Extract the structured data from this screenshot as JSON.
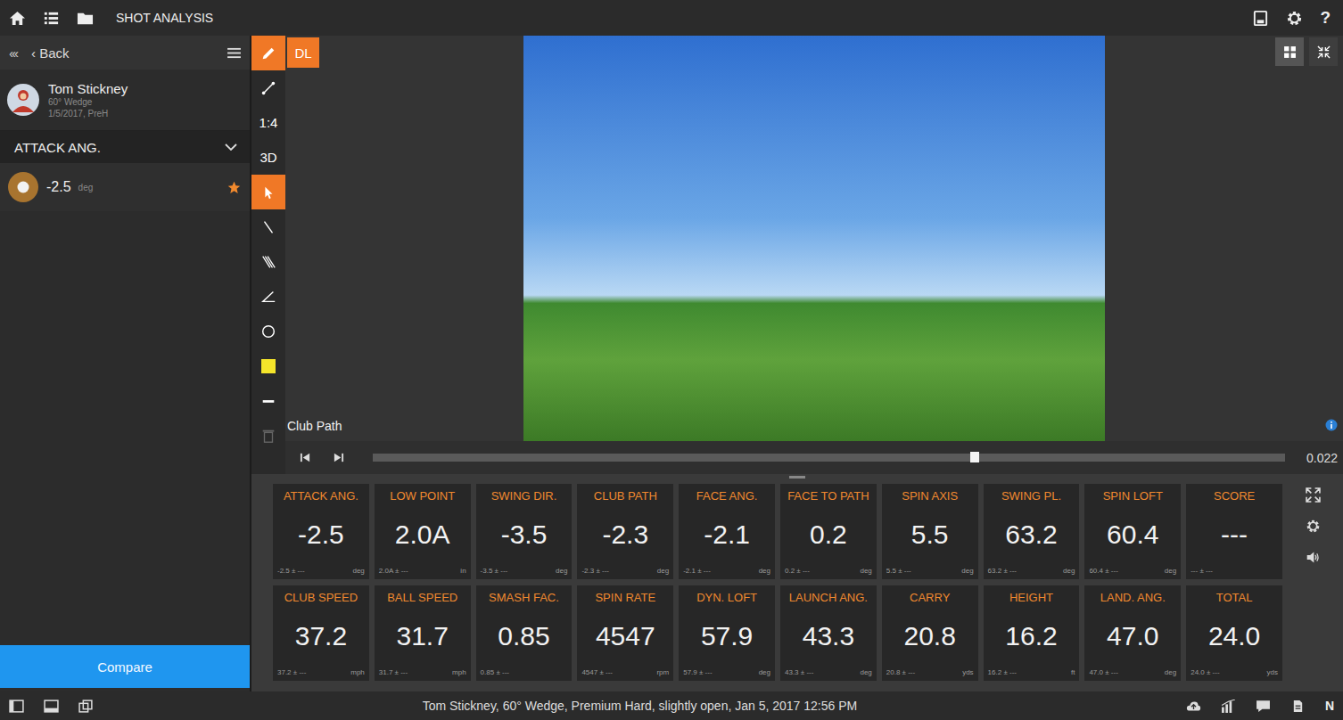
{
  "topbar": {
    "title": "SHOT ANALYSIS",
    "help": "?"
  },
  "sidebar": {
    "collapse": "‹‹‹",
    "back": "‹ Back",
    "player": {
      "name": "Tom Stickney",
      "club": "60° Wedge",
      "session": "1/5/2017, PreH"
    },
    "section": {
      "label": "ATTACK ANG.",
      "expanded": true
    },
    "shots": [
      {
        "value": "-2.5",
        "unit": "deg",
        "starred": true,
        "selected": true
      }
    ],
    "compare": "Compare"
  },
  "tools": [
    {
      "kind": "pencil",
      "selected": true
    },
    {
      "kind": "segment",
      "selected": false
    },
    {
      "kind": "text",
      "label": "1:4",
      "selected": false
    },
    {
      "kind": "text",
      "label": "3D",
      "selected": false
    },
    {
      "kind": "cursor",
      "selected": true
    },
    {
      "kind": "line",
      "selected": false
    },
    {
      "kind": "parallel",
      "selected": false
    },
    {
      "kind": "angle",
      "selected": false
    },
    {
      "kind": "circle",
      "selected": false
    },
    {
      "kind": "swatch",
      "selected": false
    },
    {
      "kind": "dash",
      "selected": false
    },
    {
      "kind": "trash",
      "selected": false
    }
  ],
  "dl": {
    "label": "DL",
    "on": true
  },
  "viewer": {
    "overlay_label": "Club Path",
    "time": "0.022",
    "level": 0.66,
    "grid_on": true
  },
  "metrics": [
    {
      "label": "ATTACK ANG.",
      "value": "-2.5",
      "sub": "-2.5 ± ---",
      "unit": "deg"
    },
    {
      "label": "LOW POINT",
      "value": "2.0A",
      "sub": "2.0A ± ---",
      "unit": "in"
    },
    {
      "label": "SWING DIR.",
      "value": "-3.5",
      "sub": "-3.5 ± ---",
      "unit": "deg"
    },
    {
      "label": "CLUB PATH",
      "value": "-2.3",
      "sub": "-2.3 ± ---",
      "unit": "deg"
    },
    {
      "label": "FACE ANG.",
      "value": "-2.1",
      "sub": "-2.1 ± ---",
      "unit": "deg"
    },
    {
      "label": "FACE TO PATH",
      "value": "0.2",
      "sub": "0.2 ± ---",
      "unit": "deg"
    },
    {
      "label": "SPIN AXIS",
      "value": "5.5",
      "sub": "5.5 ± ---",
      "unit": "deg"
    },
    {
      "label": "SWING PL.",
      "value": "63.2",
      "sub": "63.2 ± ---",
      "unit": "deg"
    },
    {
      "label": "SPIN LOFT",
      "value": "60.4",
      "sub": "60.4 ± ---",
      "unit": "deg"
    },
    {
      "label": "SCORE",
      "value": "---",
      "sub": "--- ± ---",
      "unit": ""
    },
    {
      "label": "CLUB SPEED",
      "value": "37.2",
      "sub": "37.2 ± ---",
      "unit": "mph"
    },
    {
      "label": "BALL SPEED",
      "value": "31.7",
      "sub": "31.7 ± ---",
      "unit": "mph"
    },
    {
      "label": "SMASH FAC.",
      "value": "0.85",
      "sub": "0.85 ± ---",
      "unit": ""
    },
    {
      "label": "SPIN RATE",
      "value": "4547",
      "sub": "4547 ± ---",
      "unit": "rpm"
    },
    {
      "label": "DYN. LOFT",
      "value": "57.9",
      "sub": "57.9 ± ---",
      "unit": "deg"
    },
    {
      "label": "LAUNCH ANG.",
      "value": "43.3",
      "sub": "43.3 ± ---",
      "unit": "deg"
    },
    {
      "label": "CARRY",
      "value": "20.8",
      "sub": "20.8 ± ---",
      "unit": "yds"
    },
    {
      "label": "HEIGHT",
      "value": "16.2",
      "sub": "16.2 ± ---",
      "unit": "ft"
    },
    {
      "label": "LAND. ANG.",
      "value": "47.0",
      "sub": "47.0 ± ---",
      "unit": "deg"
    },
    {
      "label": "TOTAL",
      "value": "24.0",
      "sub": "24.0 ± ---",
      "unit": "yds"
    }
  ],
  "status_bar": {
    "text": "Tom Stickney, 60° Wedge, Premium Hard, slightly open, Jan 5, 2017 12:56 PM",
    "badge": "N"
  }
}
